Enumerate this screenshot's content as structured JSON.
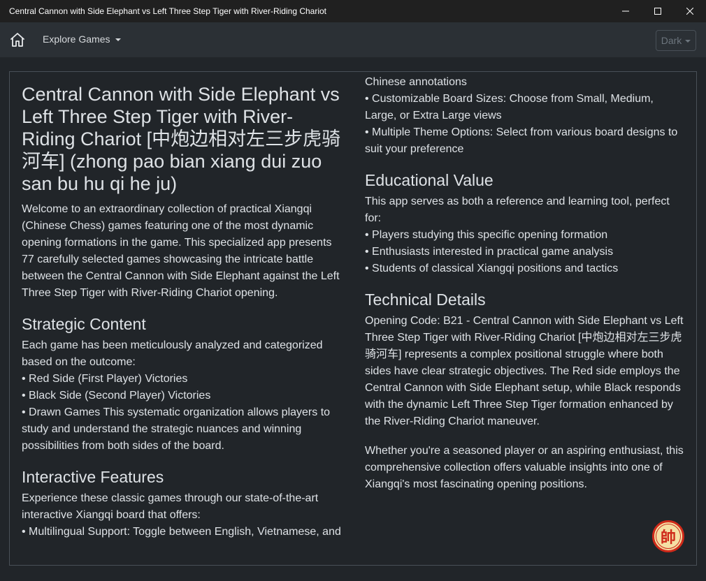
{
  "window": {
    "title": "Central Cannon with Side Elephant vs Left Three Step Tiger with River-Riding Chariot",
    "minimize_icon": "minimize-icon",
    "maximize_icon": "maximize-icon",
    "close_icon": "close-icon"
  },
  "navbar": {
    "home_icon": "home-icon",
    "explore_label": "Explore Games",
    "theme_label": "Dark"
  },
  "content": {
    "title": "Central Cannon with Side Elephant vs Left Three Step Tiger with River-Riding Chariot [中炮边相对左三步虎骑河车] (zhong pao bian xiang dui zuo san bu hu qi he ju)",
    "intro": "Welcome to an extraordinary collection of practical Xiangqi (Chinese Chess) games featuring one of the most dynamic opening formations in the game. This specialized app presents 77 carefully selected games showcasing the intricate battle between the Central Cannon with Side Elephant against the Left Three Step Tiger with River-Riding Chariot opening.",
    "strategic": {
      "heading": "Strategic Content",
      "lead": "Each game has been meticulously analyzed and categorized based on the outcome:",
      "items": [
        "• Red Side (First Player) Victories",
        "• Black Side (Second Player) Victories",
        "• Drawn Games This systematic organization allows players to study and understand the strategic nuances and winning possibilities from both sides of the board."
      ]
    },
    "interactive": {
      "heading": "Interactive Features",
      "lead": "Experience these classic games through our state-of-the-art interactive Xiangqi board that offers:",
      "items": [
        "• Multilingual Support: Toggle between English, Vietnamese, and Chinese annotations",
        "• Customizable Board Sizes: Choose from Small, Medium, Large, or Extra Large views",
        "• Multiple Theme Options: Select from various board designs to suit your preference"
      ]
    },
    "educational": {
      "heading": "Educational Value",
      "lead": "This app serves as both a reference and learning tool, perfect for:",
      "items": [
        "• Players studying this specific opening formation",
        "• Enthusiasts interested in practical game analysis",
        "• Students of classical Xiangqi positions and tactics"
      ]
    },
    "technical": {
      "heading": "Technical Details",
      "body": "Opening Code: B21 - Central Cannon with Side Elephant vs Left Three Step Tiger with River-Riding Chariot [中炮边相对左三步虎骑河车] represents a complex positional struggle where both sides have clear strategic objectives. The Red side employs the Central Cannon with Side Elephant setup, while Black responds with the dynamic Left Three Step Tiger formation enhanced by the River-Riding Chariot maneuver.",
      "closing": "Whether you're a seasoned player or an aspiring enthusiast, this comprehensive collection offers valuable insights into one of Xiangqi's most fascinating opening positions."
    },
    "logo_char": "帥",
    "logo_icon": "xiangqi-general-piece-icon"
  },
  "colors": {
    "background": "#212529",
    "navbar": "#2b3035",
    "titlebar": "#202020",
    "border": "#495057",
    "text": "#dee2e6",
    "logo_red": "#cf2a1a",
    "logo_fill": "#f5dfa4"
  }
}
